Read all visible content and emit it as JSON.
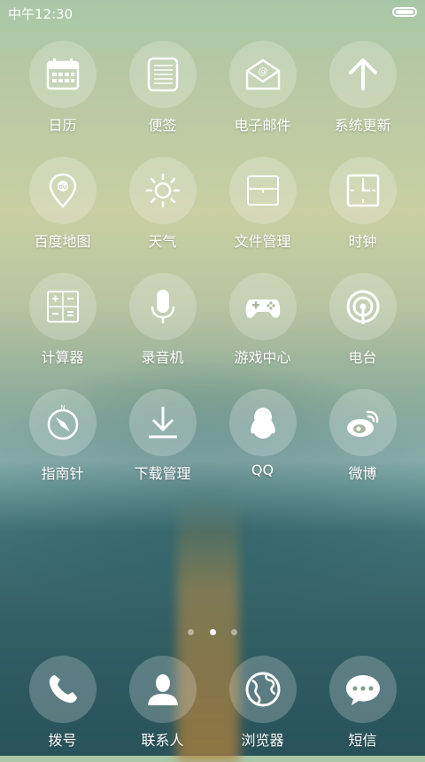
{
  "status": {
    "time": "中午12:30",
    "battery_level": 1.0
  },
  "apps": [
    {
      "label": "日历",
      "icon": "calendar-icon"
    },
    {
      "label": "便签",
      "icon": "notepad-icon"
    },
    {
      "label": "电子邮件",
      "icon": "email-icon"
    },
    {
      "label": "系统更新",
      "icon": "update-arrow-icon"
    },
    {
      "label": "百度地图",
      "icon": "baidu-map-pin-icon"
    },
    {
      "label": "天气",
      "icon": "sun-icon"
    },
    {
      "label": "文件管理",
      "icon": "folder-icon"
    },
    {
      "label": "时钟",
      "icon": "clock-icon"
    },
    {
      "label": "计算器",
      "icon": "calculator-icon"
    },
    {
      "label": "录音机",
      "icon": "microphone-icon"
    },
    {
      "label": "游戏中心",
      "icon": "gamepad-icon"
    },
    {
      "label": "电台",
      "icon": "radio-icon"
    },
    {
      "label": "指南针",
      "icon": "compass-icon"
    },
    {
      "label": "下载管理",
      "icon": "download-icon"
    },
    {
      "label": "QQ",
      "icon": "qq-penguin-icon"
    },
    {
      "label": "微博",
      "icon": "weibo-icon"
    }
  ],
  "pager": {
    "pages": 3,
    "current": 2
  },
  "dock": [
    {
      "label": "拨号",
      "icon": "phone-icon"
    },
    {
      "label": "联系人",
      "icon": "contact-icon"
    },
    {
      "label": "浏览器",
      "icon": "globe-icon"
    },
    {
      "label": "短信",
      "icon": "message-bubble-icon"
    }
  ]
}
